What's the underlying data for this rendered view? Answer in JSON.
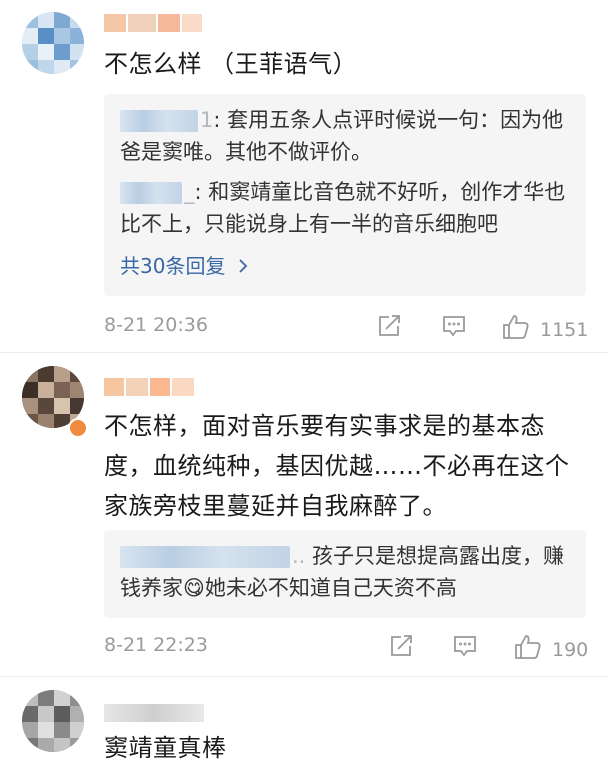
{
  "comments": [
    {
      "text": "不怎么样 （王菲语气）",
      "replies": [
        {
          "name_tail": "1",
          "text": ": 套用五条人点评时候说一句：因为他爸是窦唯。其他不做评价。"
        },
        {
          "name_tail": "_",
          "text": ": 和窦靖童比音色就不好听，创作才华也比不上，只能说身上有一半的音乐细胞吧"
        }
      ],
      "more_replies": "共30条回复",
      "time": "8-21 20:36",
      "likes": "1151"
    },
    {
      "text": "不怎样，面对音乐要有实事求是的基本态度，血统纯种，基因优越……不必再在这个家族旁枝里蔓延并自我麻醉了。",
      "replies": [
        {
          "name_tail": "..",
          "text": " 孩子只是想提高露出度，赚钱养家",
          "emoji": "😋",
          "text2": "她未必不知道自己天资不高"
        }
      ],
      "time": "8-21 22:23",
      "likes": "190"
    },
    {
      "text": "窦靖童真棒"
    }
  ],
  "colors": {
    "link": "#3a67a6",
    "meta": "#9a9a9a",
    "reply_bg": "#f5f5f5"
  },
  "icons": {
    "share": "share-icon",
    "comment": "comment-icon",
    "like": "thumbs-up-icon"
  }
}
